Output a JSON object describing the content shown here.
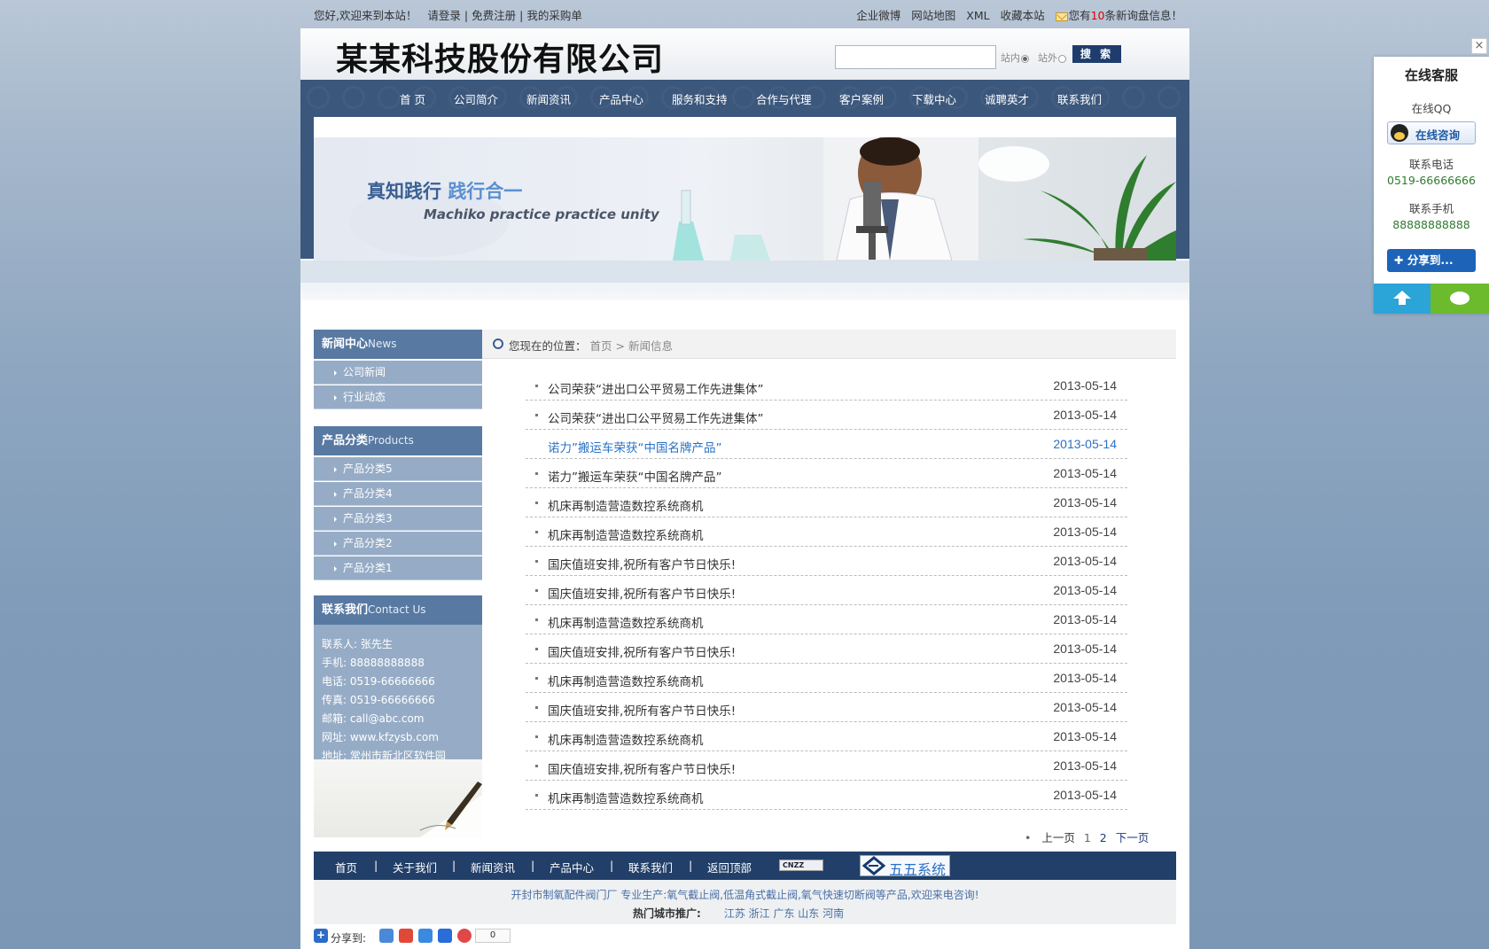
{
  "topbar": {
    "welcome": "您好,欢迎来到本站！",
    "login": "请登录",
    "sep": "|",
    "register": "免费注册",
    "cart": "我的采购单",
    "links": [
      "企业微博",
      "网站地图",
      "XML",
      "收藏本站"
    ],
    "inquiry_pre": "您有",
    "inquiry_count": "10",
    "inquiry_post": "条新询盘信息！"
  },
  "header": {
    "company_name": "某某科技股份有限公司",
    "search_placeholder": "",
    "radio_site": "站内",
    "radio_external": "站外",
    "search_button": "搜 索"
  },
  "nav": [
    "首 页",
    "公司简介",
    "新闻资讯",
    "产品中心",
    "服务和支持",
    "合作与代理",
    "客户案例",
    "下载中心",
    "诚聘英才",
    "联系我们"
  ],
  "banner": {
    "slogan_a": "真知践行 ",
    "slogan_b": "践行合一",
    "subtitle": "Machiko practice practice unity"
  },
  "sidebar": {
    "news_head_cn": "新闻中心",
    "news_head_en": "News",
    "news_items": [
      "公司新闻",
      "行业动态"
    ],
    "products_head_cn": "产品分类",
    "products_head_en": "Products",
    "product_items": [
      "产品分类5",
      "产品分类4",
      "产品分类3",
      "产品分类2",
      "产品分类1"
    ],
    "contact_head_cn": "联系我们",
    "contact_head_en": "Contact Us",
    "contact_lines": [
      "联系人: 张先生",
      "手机: 88888888888",
      "电话: 0519-66666666",
      "传真: 0519-66666666",
      "邮箱: call@abc.com",
      "网址: www.kfzysb.com",
      "地址: 常州市新北区软件园"
    ]
  },
  "breadcrumb": {
    "prefix": "您现在的位置：",
    "home": "首页",
    "arrow": ">",
    "current": "新闻信息"
  },
  "news": [
    {
      "title": "公司荣获“进出口公平贸易工作先进集体”",
      "date": "2013-05-14"
    },
    {
      "title": "公司荣获“进出口公平贸易工作先进集体”",
      "date": "2013-05-14"
    },
    {
      "title": "诺力”搬运车荣获“中国名牌产品”",
      "date": "2013-05-14"
    },
    {
      "title": "诺力”搬运车荣获“中国名牌产品”",
      "date": "2013-05-14"
    },
    {
      "title": "机床再制造营造数控系统商机",
      "date": "2013-05-14"
    },
    {
      "title": "机床再制造营造数控系统商机",
      "date": "2013-05-14"
    },
    {
      "title": "国庆值班安排,祝所有客户节日快乐!",
      "date": "2013-05-14"
    },
    {
      "title": "国庆值班安排,祝所有客户节日快乐!",
      "date": "2013-05-14"
    },
    {
      "title": "机床再制造营造数控系统商机",
      "date": "2013-05-14"
    },
    {
      "title": "国庆值班安排,祝所有客户节日快乐!",
      "date": "2013-05-14"
    },
    {
      "title": "机床再制造营造数控系统商机",
      "date": "2013-05-14"
    },
    {
      "title": "国庆值班安排,祝所有客户节日快乐!",
      "date": "2013-05-14"
    },
    {
      "title": "机床再制造营造数控系统商机",
      "date": "2013-05-14"
    },
    {
      "title": "国庆值班安排,祝所有客户节日快乐!",
      "date": "2013-05-14"
    },
    {
      "title": "机床再制造营造数控系统商机",
      "date": "2013-05-14"
    }
  ],
  "pager": {
    "prev": "上一页",
    "page1": "1",
    "page2": "2",
    "next": "下一页"
  },
  "footer": {
    "nav": [
      "首页",
      "关于我们",
      "新闻资讯",
      "产品中心",
      "联系我们",
      "返回顶部"
    ],
    "sep": "|",
    "cnzz": "CNZZ",
    "badge": "五五系统",
    "line1": "开封市制氧配件阀门厂 专业生产:氧气截止阀,低温角式截止阀,氧气快速切断阀等产品,欢迎来电咨询!",
    "hot_label": "热门城市推广:",
    "hot_cities": "江苏 浙江 广东 山东 河南",
    "share_label": "分享到:",
    "share_count": "0"
  },
  "service": {
    "close": "×",
    "title": "在线客服",
    "qq_label": "在线QQ",
    "qq_button": "在线咨询",
    "phone_label": "联系电话",
    "phone": "0519-66666666",
    "mobile_label": "联系手机",
    "mobile": "88888888888",
    "share_button": "✚ 分享到..."
  },
  "colors": {
    "nav_bg": "#3b577c",
    "sidebar_head": "#5879a2",
    "sidebar_item": "#96acc6",
    "footer_nav": "#223f69",
    "link_highlight": "#2a72c5"
  }
}
